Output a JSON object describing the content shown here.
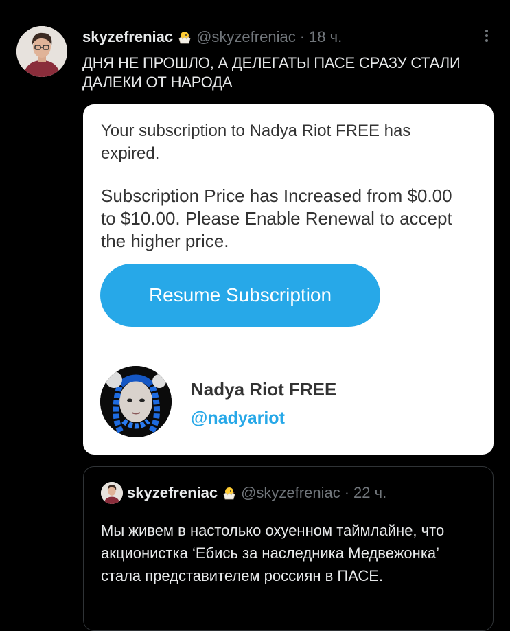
{
  "tweet": {
    "name": "skyzefreniac",
    "handle": "@skyzefreniac",
    "separator": "·",
    "time": "18 ч.",
    "text": "ДНЯ НЕ ПРОШЛО, А ДЕЛЕГАТЫ ПАСЕ СРАЗУ СТАЛИ ДАЛЕКИ ОТ НАРОДА"
  },
  "card": {
    "notice_expired": "Your subscription to Nadya Riot FREE has expired.",
    "notice_price": "Subscription Price has Increased from $0.00 to $10.00. Please Enable Renewal to accept the higher price.",
    "resume_button_label": "Resume Subscription",
    "profile_name": "Nadya Riot FREE",
    "profile_handle": "@nadyariot",
    "accent_color": "#27a8e8"
  },
  "quoted_tweet": {
    "name": "skyzefreniac",
    "handle": "@skyzefreniac",
    "separator": "·",
    "time": "22 ч.",
    "text": "Мы живем в настолько охуенном таймлайне, что акционистка ‘Ебись за наследника Медвежонка’ стала представителем россиян в ПАСЕ."
  },
  "icons": [
    "hatching-chick-emoji",
    "more-vertical-icon"
  ]
}
